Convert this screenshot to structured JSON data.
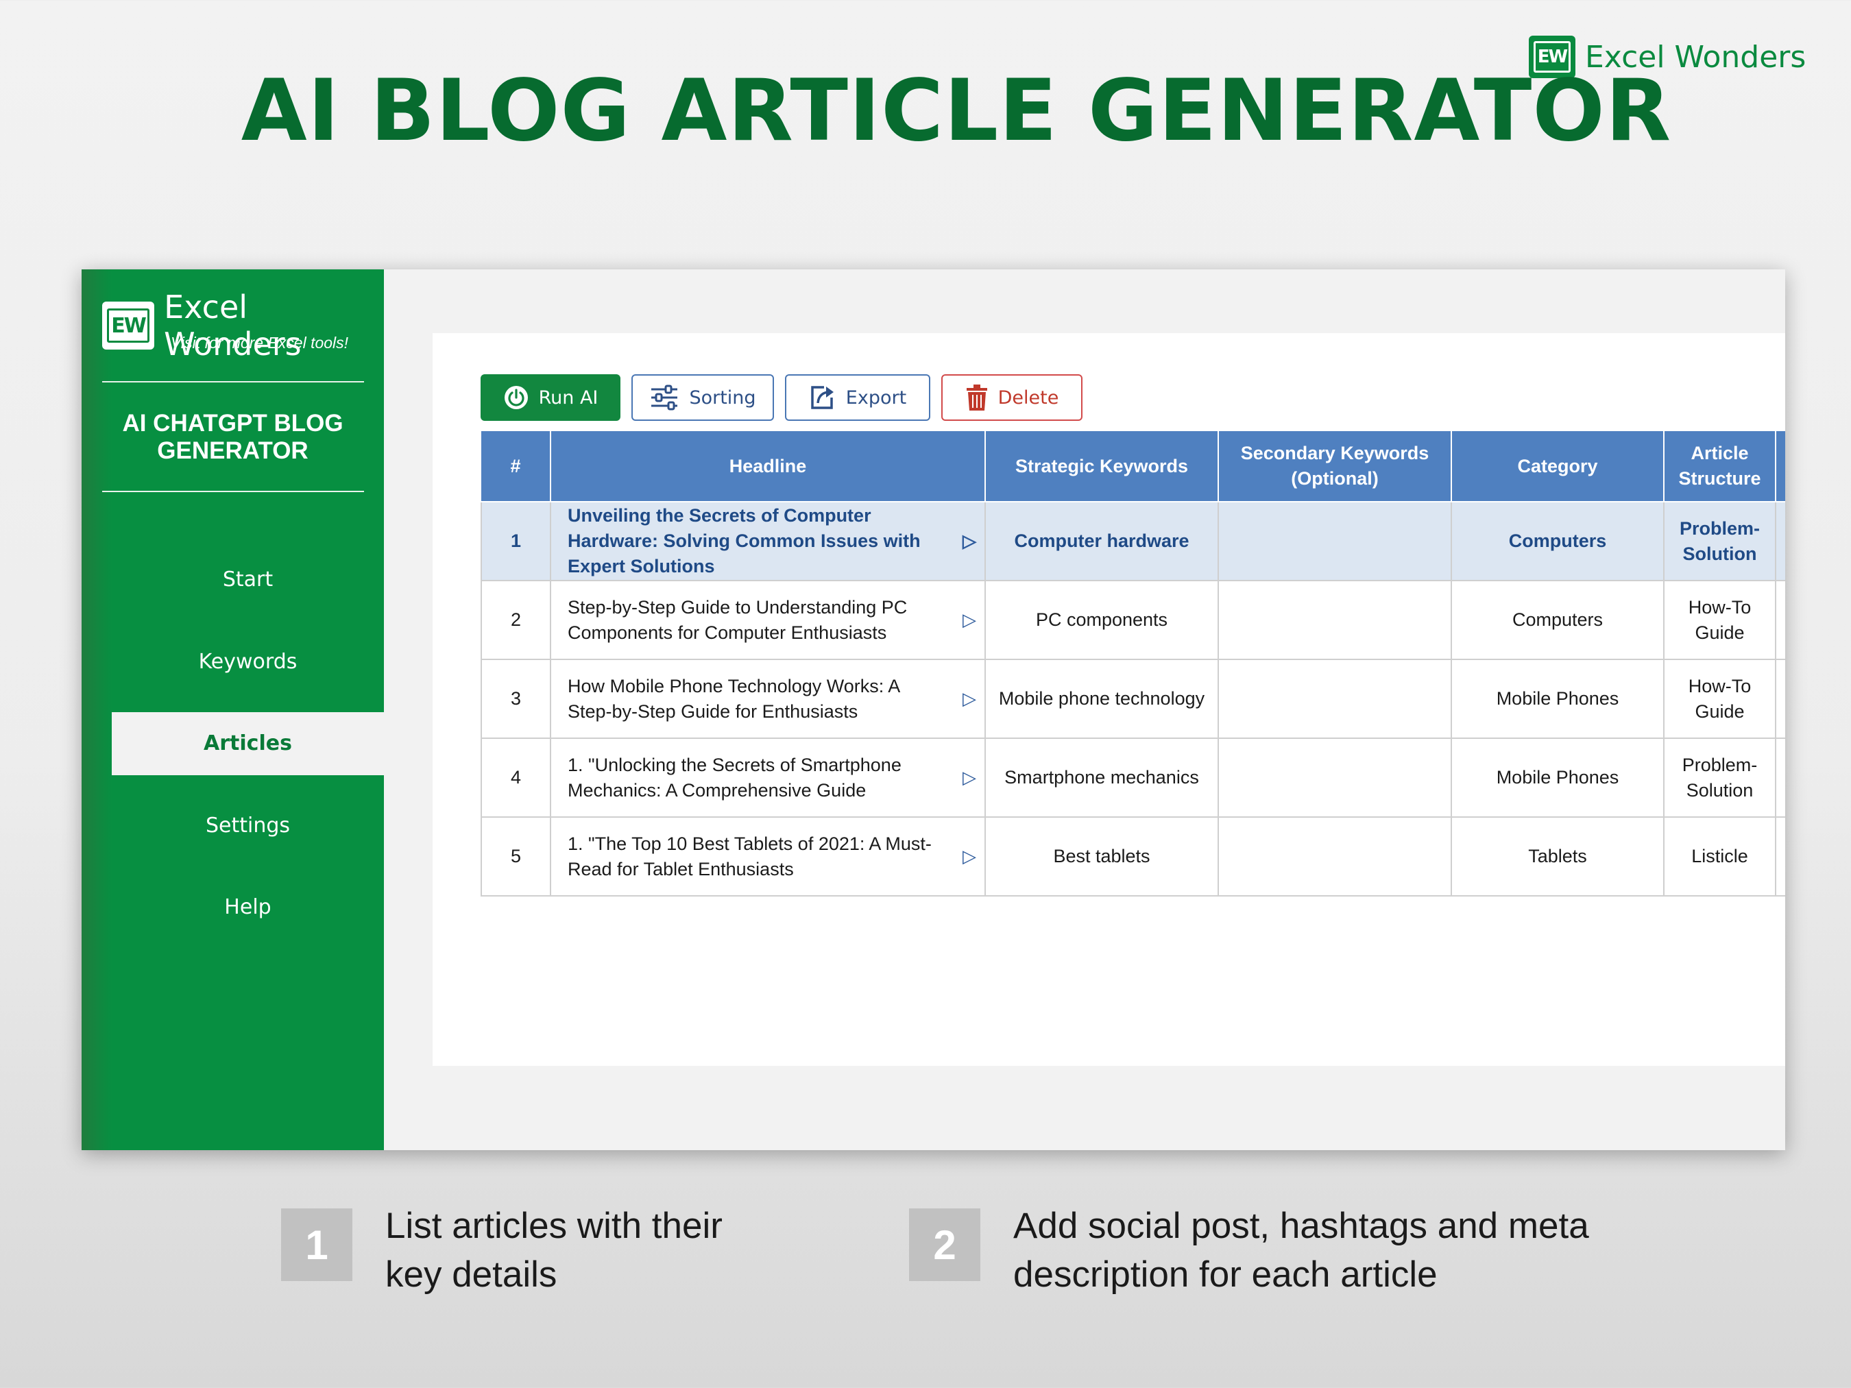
{
  "page": {
    "title": "AI BLOG ARTICLE GENERATOR",
    "brand": "Excel Wonders",
    "logo_mark": "EW"
  },
  "sidebar": {
    "brand": "Excel Wonders",
    "logo_mark": "EW",
    "tagline": "Visit for more Excel tools!",
    "app_title_line1": "AI CHATGPT BLOG",
    "app_title_line2": "GENERATOR",
    "items": [
      {
        "label": "Start",
        "active": false
      },
      {
        "label": "Keywords",
        "active": false
      },
      {
        "label": "Articles",
        "active": true
      },
      {
        "label": "Settings",
        "active": false
      },
      {
        "label": "Help",
        "active": false
      }
    ]
  },
  "toolbar": {
    "run_label": "Run AI",
    "sort_label": "Sorting",
    "export_label": "Export",
    "delete_label": "Delete"
  },
  "table": {
    "columns": [
      "#",
      "Headline",
      "Strategic Keywords",
      "Secondary Keywords (Optional)",
      "Category",
      "Article Structure"
    ],
    "rows": [
      {
        "num": "1",
        "headline": "Unveiling the Secrets of Computer Hardware: Solving Common Issues with Expert Solutions",
        "keywords": "Computer hardware",
        "secondary": "",
        "category": "Computers",
        "structure": "Problem-Solution",
        "selected": true
      },
      {
        "num": "2",
        "headline": "Step-by-Step Guide to Understanding PC Components for Computer Enthusiasts",
        "keywords": "PC components",
        "secondary": "",
        "category": "Computers",
        "structure": "How-To Guide",
        "selected": false
      },
      {
        "num": "3",
        "headline": "How Mobile Phone Technology Works: A Step-by-Step Guide for Enthusiasts",
        "keywords": "Mobile phone technology",
        "secondary": "",
        "category": "Mobile Phones",
        "structure": "How-To Guide",
        "selected": false
      },
      {
        "num": "4",
        "headline": "1. \"Unlocking the Secrets of Smartphone Mechanics: A Comprehensive Guide",
        "keywords": "Smartphone mechanics",
        "secondary": "",
        "category": "Mobile Phones",
        "structure": "Problem-Solution",
        "selected": false
      },
      {
        "num": "5",
        "headline": "1. \"The Top 10 Best Tablets of 2021: A Must-Read for Tablet Enthusiasts",
        "keywords": "Best tablets",
        "secondary": "",
        "category": "Tablets",
        "structure": "Listicle",
        "selected": false
      }
    ]
  },
  "features": [
    {
      "number": "1",
      "line1": "List articles with their",
      "line2": "key details"
    },
    {
      "number": "2",
      "line1": "Add social post, hashtags and meta",
      "line2": "description for each article"
    }
  ],
  "colors": {
    "brand_green": "#0a8a3f",
    "title_green": "#076b2f",
    "header_blue": "#4f80c0",
    "selected_row": "#dce6f2",
    "delete_red": "#c0392b"
  },
  "icons": {
    "run": "power-icon",
    "sort": "sliders-icon",
    "export": "export-icon",
    "delete": "trash-icon",
    "row_action": "play-icon"
  }
}
